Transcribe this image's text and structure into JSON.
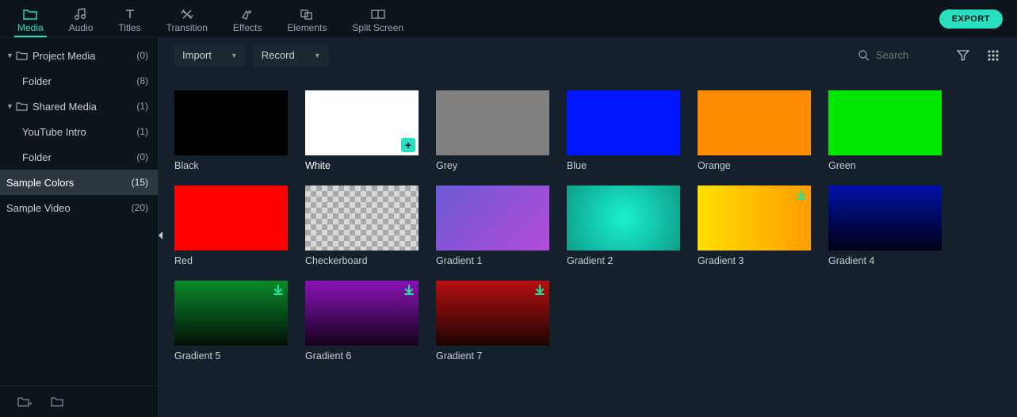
{
  "tabs": [
    {
      "key": "media",
      "label": "Media",
      "active": true
    },
    {
      "key": "audio",
      "label": "Audio",
      "active": false
    },
    {
      "key": "titles",
      "label": "Titles",
      "active": false
    },
    {
      "key": "transition",
      "label": "Transition",
      "active": false
    },
    {
      "key": "effects",
      "label": "Effects",
      "active": false
    },
    {
      "key": "elements",
      "label": "Elements",
      "active": false
    },
    {
      "key": "splitscreen",
      "label": "Split Screen",
      "active": false
    }
  ],
  "export_label": "EXPORT",
  "sidebar": [
    {
      "label": "Project Media",
      "count": "(0)",
      "type": "folder",
      "expand": true,
      "level": 0
    },
    {
      "label": "Folder",
      "count": "(8)",
      "type": "child",
      "level": 1
    },
    {
      "label": "Shared Media",
      "count": "(1)",
      "type": "folder",
      "expand": true,
      "level": 0
    },
    {
      "label": "YouTube Intro",
      "count": "(1)",
      "type": "child",
      "level": 1
    },
    {
      "label": "Folder",
      "count": "(0)",
      "type": "child",
      "level": 1
    },
    {
      "label": "Sample Colors",
      "count": "(15)",
      "type": "plain",
      "level": 0,
      "selected": true
    },
    {
      "label": "Sample Video",
      "count": "(20)",
      "type": "plain",
      "level": 0
    }
  ],
  "toolbar": {
    "import": "Import",
    "record": "Record",
    "search_placeholder": "Search"
  },
  "swatches": [
    {
      "label": "Black",
      "bg": "#000000"
    },
    {
      "label": "White",
      "bg": "#ffffff",
      "add": true,
      "active": true
    },
    {
      "label": "Grey",
      "bg": "#808080"
    },
    {
      "label": "Blue",
      "bg": "#0016ff"
    },
    {
      "label": "Orange",
      "bg": "#ff8c00"
    },
    {
      "label": "Green",
      "bg": "#00e600"
    },
    {
      "label": "Red",
      "bg": "#ff0000"
    },
    {
      "label": "Checkerboard",
      "checker": true
    },
    {
      "label": "Gradient 1",
      "gradient": "linear-gradient(135deg,#6a5bd7,#b44bd8)"
    },
    {
      "label": "Gradient 2",
      "gradient": "radial-gradient(circle,#1af0d0,#0e9e89)"
    },
    {
      "label": "Gradient 3",
      "gradient": "linear-gradient(90deg,#ffe000,#ff9c00)",
      "download": true
    },
    {
      "label": "Gradient 4",
      "gradient": "linear-gradient(180deg,#0012a8,#000016)"
    },
    {
      "label": "Gradient 5",
      "gradient": "linear-gradient(180deg,#0a8a2a,#021006)",
      "download": true
    },
    {
      "label": "Gradient 6",
      "gradient": "linear-gradient(180deg,#8a12b8,#16021c)",
      "download": true
    },
    {
      "label": "Gradient 7",
      "gradient": "linear-gradient(180deg,#b80f0f,#1c0404)",
      "download": true
    }
  ]
}
